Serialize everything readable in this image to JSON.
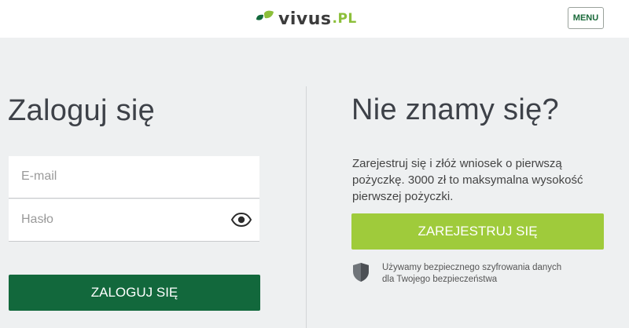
{
  "header": {
    "logo": {
      "name": "vivus",
      "tld": ".PL",
      "icon": "leaf-logo-icon"
    },
    "menu_label": "MENU"
  },
  "login": {
    "title": "Zaloguj się",
    "email_placeholder": "E-mail",
    "password_placeholder": "Hasło",
    "show_password_icon": "eye-icon",
    "submit_label": "ZALOGUJ SIĘ"
  },
  "register": {
    "title": "Nie znamy się?",
    "description": "Zarejestruj się i złóż wniosek o pierwszą pożyczkę. 3000 zł to maksymalna wysokość pierwszej pożyczki.",
    "button_label": "ZAREJESTRUJ SIĘ",
    "security_line1": "Używamy bezpiecznego szyfrowania danych",
    "security_line2": "dla Twojego bezpieczeństwa",
    "security_icon": "shield-icon"
  },
  "colors": {
    "brand_green_dark": "#12683c",
    "brand_green_light": "#9fcb3b",
    "background": "#eef0f1"
  }
}
